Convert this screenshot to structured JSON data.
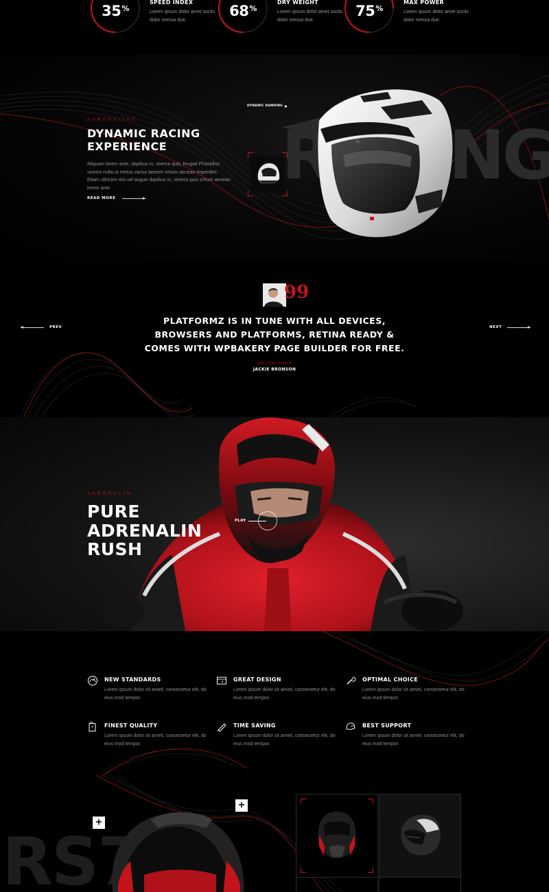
{
  "stats": [
    {
      "value": "35",
      "unit": "%",
      "title": "SPEED INDEX",
      "desc": "Lorem ipsum dolor amet sociis dolor messa due.",
      "fraction": 0.35
    },
    {
      "value": "68",
      "unit": "%",
      "title": "DRY WEIGHT",
      "desc": "Lorem ipsum dolor amet sociis dolor messa due.",
      "fraction": 0.68
    },
    {
      "value": "75",
      "unit": "%",
      "title": "MAX POWER",
      "desc": "Lorem ipsum dolor amet sociis dolor messa due.",
      "fraction": 0.75
    }
  ],
  "feature": {
    "eyebrow": "ADRENALINE",
    "title": "DYNAMIC RACING EXPERIENCE",
    "body": "Aliquam lorem ante, dapibus in, viverra quis, feugiat Phasellus viverra nulla ut metus varius laoreet srtrum aenean imperdiet. Etiam ultricies nisi vel augue dapibus in, viverra quis srtrum aenean lorem ante.",
    "read_more": "READ MORE",
    "hotspot": "DYNAMIC DAMPING",
    "bg_word": "RACING"
  },
  "testimonial": {
    "quote": "PLATFORMZ IS IN TUNE WITH ALL DEVICES, BROWSERS AND PLATFORMS, RETINA READY & COMES WITH WPBAKERY PAGE BUILDER FOR FREE.",
    "role": "OFFICIAL RIDER",
    "author": "JACKIE BRONSON",
    "prev": "PREV",
    "next": "NEXT",
    "quote_mark": "99"
  },
  "adrenalin": {
    "eyebrow": "ADRENALIN",
    "title_lines": [
      "PURE",
      "ADRENALIN",
      "RUSH"
    ],
    "play": "PLAY"
  },
  "features": [
    {
      "title": "NEW STANDARDS",
      "desc": "Lorem ipsum dolor sit ameti, consectetur elit, do eius mod tempor.",
      "icon": "speedometer-icon"
    },
    {
      "title": "GREAT DESIGN",
      "desc": "Lorem ipsum dolor sit ameti, consectetur elit, do eius mod tempor.",
      "icon": "dashboard-icon"
    },
    {
      "title": "OPTIMAL CHOICE",
      "desc": "Lorem ipsum dolor sit ameti, consectetur elit, do eius mod tempor.",
      "icon": "wrench-icon"
    },
    {
      "title": "FINEST QUALITY",
      "desc": "Lorem ipsum dolor sit ameti, consectetur elit, do eius mod tempor.",
      "icon": "fuel-can-icon"
    },
    {
      "title": "TIME SAVING",
      "desc": "Lorem ipsum dolor sit ameti, consectetur elit, do eius mod tempor.",
      "icon": "pen-icon"
    },
    {
      "title": "BEST SUPPORT",
      "desc": "Lorem ipsum dolor sit ameti, consectetur elit, do eius mod tempor.",
      "icon": "helmet-icon"
    }
  ],
  "products": {
    "bg_word": "RS789",
    "plus": "+"
  },
  "colors": {
    "accent": "#c4141b",
    "background": "#000000",
    "text": "#ffffff",
    "muted": "#8f8f8f"
  }
}
